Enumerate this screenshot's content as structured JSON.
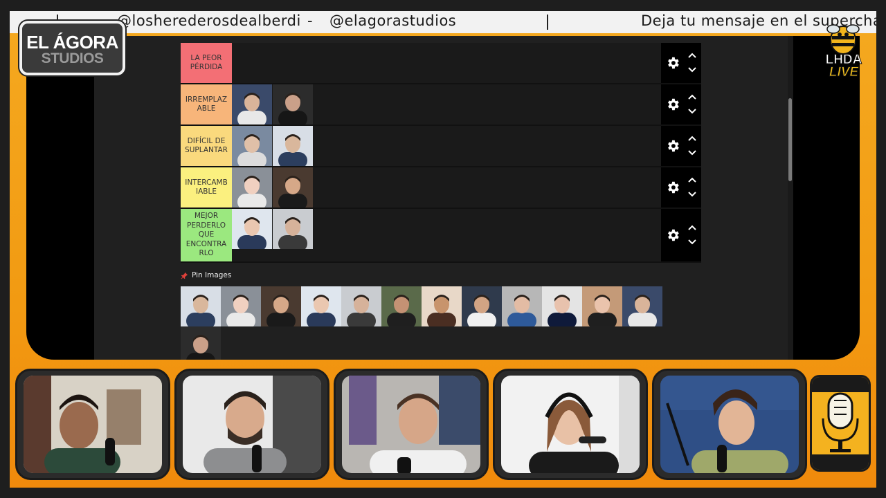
{
  "ticker": {
    "handle_1": "@losherederosdealberdi",
    "dash": "-",
    "handle_2": "@elagorastudios",
    "message": "Deja tu mensaje en el superchat"
  },
  "logo_left": {
    "line1": "EL ÁGORA",
    "line2": "STUDIOS"
  },
  "logo_right": {
    "line1": "LHDA",
    "line2": "LIVE"
  },
  "tiers": [
    {
      "label": "LA PEOR PÉRDIDA",
      "color": "#f36f75",
      "images": []
    },
    {
      "label": "IRREMPLAZ ABLE",
      "color": "#f7b57a",
      "images": [
        "portrait-1",
        "portrait-2"
      ]
    },
    {
      "label": "DIFÍCIL DE SUPLANTAR",
      "color": "#fad97d",
      "images": [
        "portrait-3",
        "portrait-4"
      ]
    },
    {
      "label": "INTERCAMB IABLE",
      "color": "#fbf07f",
      "images": [
        "portrait-5",
        "portrait-6"
      ]
    },
    {
      "label": "MEJOR PERDERLO QUE ENCONTRA RLO",
      "color": "#9be87f",
      "images": [
        "portrait-7",
        "portrait-8"
      ]
    }
  ],
  "pin_images": {
    "label": "Pin Images",
    "icon": "pushpin-icon",
    "count": 13
  },
  "colors": {
    "frame": "#f29a12",
    "background": "#202020",
    "ticker": "#f2f2f2"
  },
  "cameras": 5
}
